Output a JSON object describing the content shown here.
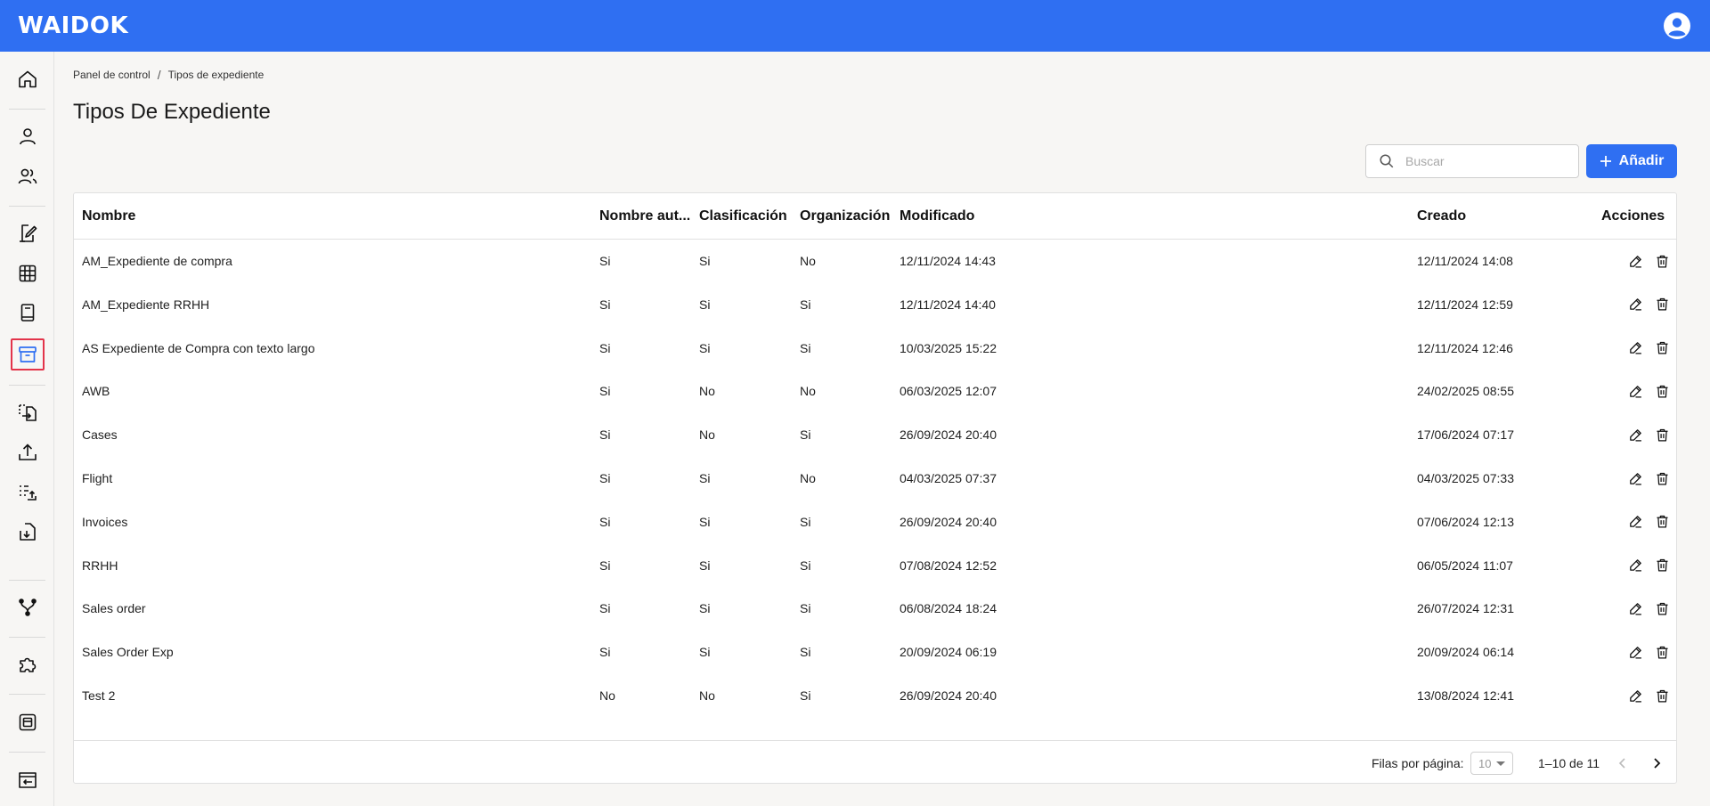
{
  "app": {
    "logo": "WAIDOK"
  },
  "breadcrumb": {
    "home": "Panel de control",
    "separator": "/",
    "current": "Tipos de expediente"
  },
  "page": {
    "title": "Tipos De Expediente"
  },
  "search": {
    "placeholder": "Buscar"
  },
  "toolbar": {
    "add_label": "Añadir"
  },
  "table": {
    "headers": {
      "nombre": "Nombre",
      "nombre_auto": "Nombre aut...",
      "clasificacion": "Clasificación",
      "organizacion": "Organización",
      "modificado": "Modificado",
      "creado": "Creado",
      "acciones": "Acciones"
    },
    "rows": [
      [
        "AM_Expediente de compra",
        "Si",
        "Si",
        "No",
        "12/11/2024 14:43",
        "12/11/2024 14:08"
      ],
      [
        "AM_Expediente RRHH",
        "Si",
        "Si",
        "Si",
        "12/11/2024 14:40",
        "12/11/2024 12:59"
      ],
      [
        "AS Expediente de Compra con texto largo",
        "Si",
        "Si",
        "Si",
        "10/03/2025 15:22",
        "12/11/2024 12:46"
      ],
      [
        "AWB",
        "Si",
        "No",
        "No",
        "06/03/2025 12:07",
        "24/02/2025 08:55"
      ],
      [
        "Cases",
        "Si",
        "No",
        "Si",
        "26/09/2024 20:40",
        "17/06/2024 07:17"
      ],
      [
        "Flight",
        "Si",
        "Si",
        "No",
        "04/03/2025 07:37",
        "04/03/2025 07:33"
      ],
      [
        "Invoices",
        "Si",
        "Si",
        "Si",
        "26/09/2024 20:40",
        "07/06/2024 12:13"
      ],
      [
        "RRHH",
        "Si",
        "Si",
        "Si",
        "07/08/2024 12:52",
        "06/05/2024 11:07"
      ],
      [
        "Sales order",
        "Si",
        "Si",
        "Si",
        "06/08/2024 18:24",
        "26/07/2024 12:31"
      ],
      [
        "Sales Order Exp",
        "Si",
        "Si",
        "Si",
        "20/09/2024 06:19",
        "20/09/2024 06:14"
      ],
      [
        "Test 2",
        "No",
        "No",
        "Si",
        "26/09/2024 20:40",
        "13/08/2024 12:41"
      ]
    ]
  },
  "pagination": {
    "rows_per_page_label": "Filas por página:",
    "rows_per_page": "10",
    "range": "1–10 de 11"
  },
  "sidebar": {
    "icons": [
      "home-icon",
      "user-icon",
      "users-icon",
      "document-edit-icon",
      "table-icon",
      "book-icon",
      "archive-icon",
      "file-transfer-icon",
      "upload-icon",
      "list-upload-icon",
      "download-document-icon",
      "workflow-icon",
      "puzzle-icon",
      "template-icon",
      "browser-exit-icon"
    ],
    "active": "archive-icon"
  },
  "colors": {
    "primary": "#2f6ff2",
    "active_outline": "#e3344a",
    "background": "#f7f6f4"
  }
}
